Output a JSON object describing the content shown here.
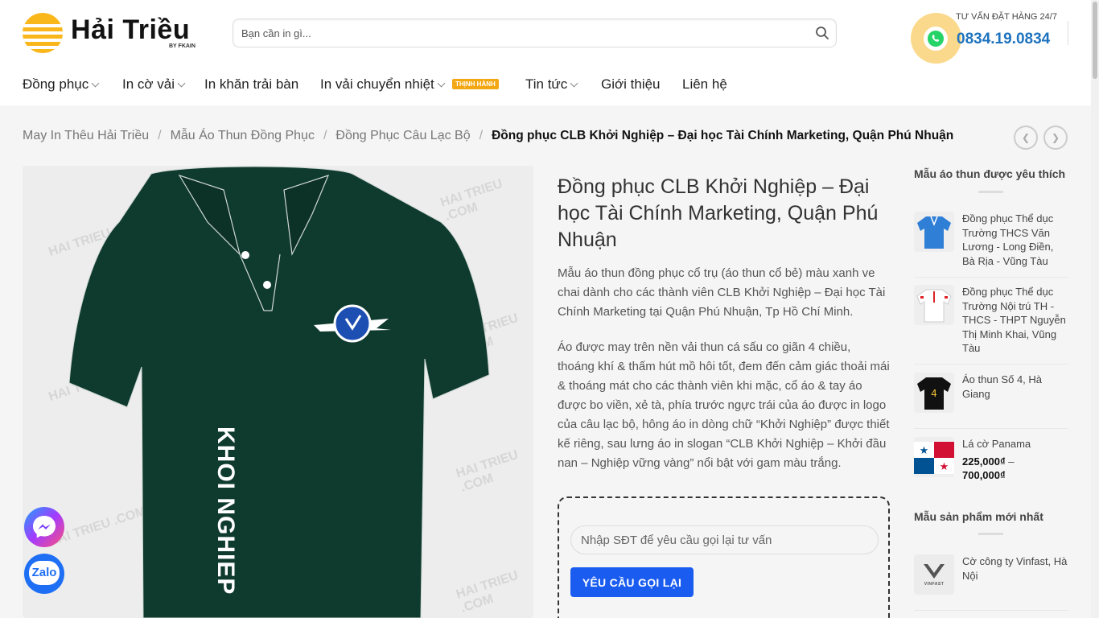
{
  "brand": {
    "name": "Hải Triều",
    "sub": "BY FKAIN"
  },
  "search": {
    "placeholder": "Bạn cần in gì..."
  },
  "hotline": {
    "label": "TƯ VẤN ĐẶT HÀNG 24/7",
    "number": "0834.19.0834"
  },
  "nav": {
    "items": [
      {
        "label": "Đồng phục",
        "dropdown": true
      },
      {
        "label": "In cờ vải",
        "dropdown": true
      },
      {
        "label": "In khăn trải bàn",
        "dropdown": false
      },
      {
        "label": "In vải chuyển nhiệt",
        "dropdown": true
      },
      {
        "label": "Tin tức",
        "dropdown": true
      },
      {
        "label": "Giới thiệu",
        "dropdown": false
      },
      {
        "label": "Liên hệ",
        "dropdown": false
      }
    ],
    "badge": "THỊNH HÀNH"
  },
  "breadcrumb": {
    "items": [
      "May In Thêu Hải Triều",
      "Mẫu Áo Thun Đồng Phục",
      "Đồng Phục Câu Lạc Bộ"
    ],
    "current": "Đồng phục CLB Khởi Nghiệp – Đại học Tài Chính Marketing, Quận Phú Nhuận"
  },
  "product": {
    "title": "Đồng phục CLB Khởi Nghiệp – Đại học Tài Chính Marketing, Quận Phú Nhuận",
    "print_text": "KHOI NGHIEP",
    "watermark": "HAI TRIEU .COM",
    "desc1": "Mẫu áo thun đồng phục cổ trụ (áo thun cổ bẻ) màu xanh ve chai dành cho các thành viên CLB Khởi Nghiệp – Đại học Tài Chính Marketing tại Quận Phú Nhuận, Tp Hồ Chí Minh.",
    "desc2": "Áo được may trên nền vải thun cá sấu co giãn 4 chiều, thoáng khí & thấm hút mồ hôi tốt, đem đến cảm giác thoải mái & thoáng mát cho các thành viên khi mặc, cổ áo & tay áo được bo viền, xẻ tà, phía trước ngực trái của áo được in logo của câu lạc bộ, hông áo in dòng chữ “Khởi Nghiệp” được thiết kế riêng, sau lưng áo in slogan “CLB Khởi Nghiệp – Khởi đầu nan – Nghiệp vững vàng” nổi bật với gam màu trắng.",
    "shirt_color": "#0f3a2e"
  },
  "callback": {
    "placeholder": "Nhập SĐT để yêu cầu gọi lại tư vấn",
    "button": "YÊU CẦU GỌI LẠI"
  },
  "sidebar": {
    "favorites_title": "Mẫu áo thun được yêu thích",
    "favorites": [
      {
        "name": "Đồng phục Thể dục Trường THCS Văn Lương - Long Điền, Bà Rịa - Vũng Tàu"
      },
      {
        "name": "Đồng phục Thể dục Trường Nội trú TH - THCS - THPT Nguyễn Thị Minh Khai, Vũng Tàu"
      },
      {
        "name": "Áo thun Số 4, Hà Giang"
      },
      {
        "name": "Lá cờ Panama",
        "price_min": "225,000₫",
        "price_sep": "–",
        "price_max": "700,000₫"
      }
    ],
    "new_title": "Mẫu sản phẩm mới nhất",
    "new": [
      {
        "name": "Cờ công ty Vinfast, Hà Nội",
        "logo_text": "VINFAST"
      }
    ]
  },
  "colors": {
    "accent": "#1e73be",
    "button": "#1a5cf0",
    "badge": "#f3a712",
    "logo": "#f9b71c"
  }
}
